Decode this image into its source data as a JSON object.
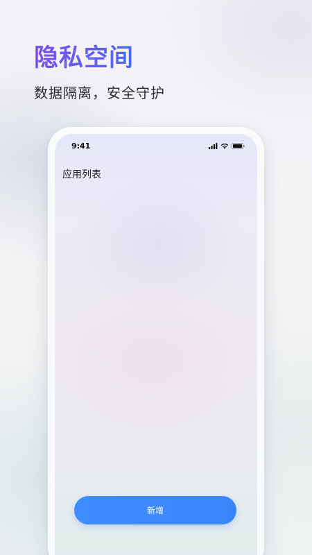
{
  "hero": {
    "title": "隐私空间",
    "subtitle": "数据隔离，安全守护"
  },
  "phone": {
    "status_bar": {
      "time": "9:41",
      "icons": [
        "signal-icon",
        "wifi-icon",
        "battery-icon"
      ]
    },
    "screen": {
      "title": "应用列表",
      "add_button_label": "新增"
    }
  },
  "colors": {
    "title_gradient_start": "#7b4fe6",
    "title_gradient_end": "#4e6cf0",
    "primary_button": "#3f8cff"
  }
}
